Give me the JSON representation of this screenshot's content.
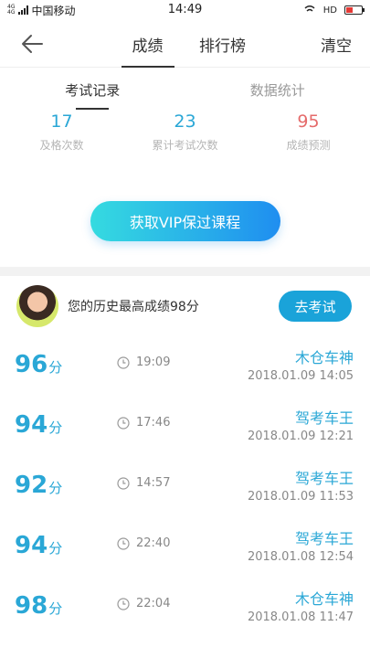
{
  "status_bar": {
    "network_top": "4G",
    "network_bottom": "4G",
    "carrier": "中国移动",
    "time": "14:49",
    "hd": "HD"
  },
  "nav": {
    "tabs": [
      "成绩",
      "排行榜"
    ],
    "active_tab": "成绩",
    "clear_label": "清空"
  },
  "subtabs": {
    "items": [
      "考试记录",
      "数据统计"
    ],
    "active": "考试记录"
  },
  "stats": [
    {
      "value": "17",
      "label": "及格次数"
    },
    {
      "value": "23",
      "label": "累计考试次数"
    },
    {
      "value": "95",
      "label": "成绩预测"
    }
  ],
  "vip_button": "获取VIP保过课程",
  "best": {
    "text": "您的历史最高成绩98分",
    "button": "去考试"
  },
  "records": [
    {
      "score": "96",
      "unit": "分",
      "duration": "19:09",
      "title": "木仓车神",
      "date": "2018.01.09  14:05"
    },
    {
      "score": "94",
      "unit": "分",
      "duration": "17:46",
      "title": "驾考车王",
      "date": "2018.01.09  12:21"
    },
    {
      "score": "92",
      "unit": "分",
      "duration": "14:57",
      "title": "驾考车王",
      "date": "2018.01.09  11:53"
    },
    {
      "score": "94",
      "unit": "分",
      "duration": "22:40",
      "title": "驾考车王",
      "date": "2018.01.08  12:54"
    },
    {
      "score": "98",
      "unit": "分",
      "duration": "22:04",
      "title": "木仓车神",
      "date": "2018.01.08  11:47"
    }
  ],
  "colors": {
    "accent": "#2aa7d6",
    "prediction": "#e56b6b",
    "button_gradient_start": "#35dbe0",
    "button_gradient_end": "#1f8ef0"
  }
}
